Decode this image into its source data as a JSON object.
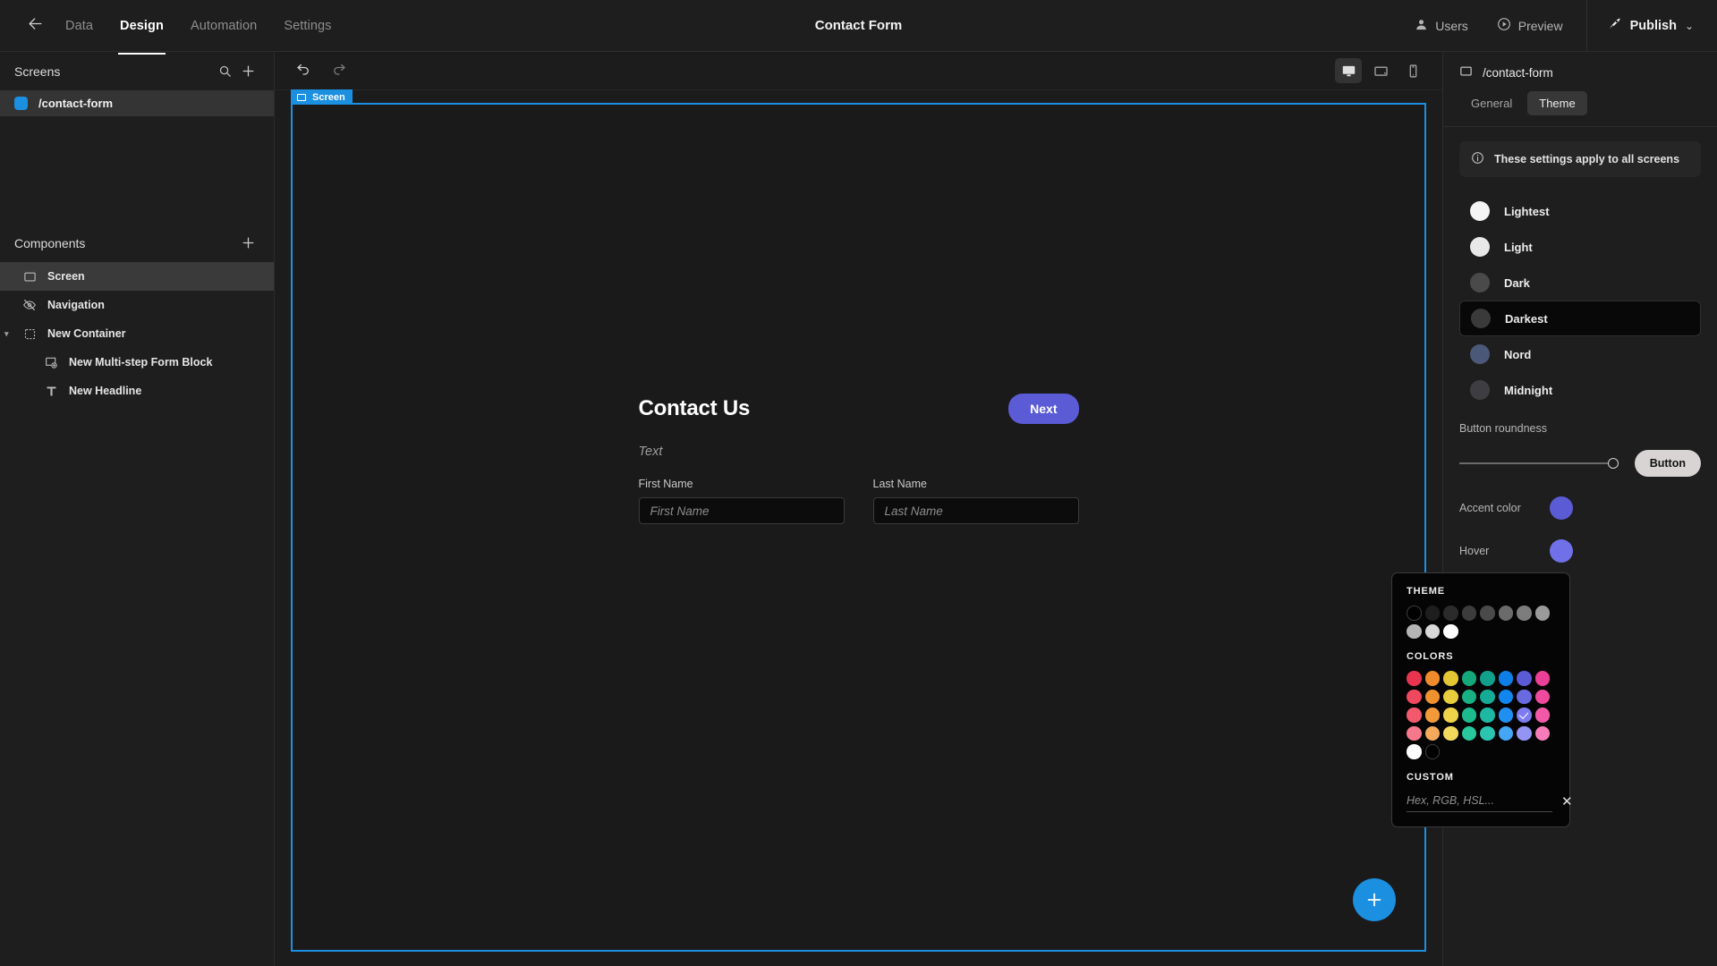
{
  "topbar": {
    "back_icon": "arrow-left-icon",
    "tabs": [
      {
        "label": "Data",
        "active": false
      },
      {
        "label": "Design",
        "active": true
      },
      {
        "label": "Automation",
        "active": false
      },
      {
        "label": "Settings",
        "active": false
      }
    ],
    "title": "Contact Form",
    "users_label": "Users",
    "preview_label": "Preview",
    "publish_label": "Publish",
    "publish_chevron": "⌄"
  },
  "left_panel": {
    "screens_header": "Screens",
    "search_icon": "search-icon",
    "add_icon": "plus-icon",
    "screens": [
      {
        "label": "/contact-form",
        "color": "#1b8fe0",
        "selected": true
      }
    ],
    "components_header": "Components",
    "components_add_icon": "plus-icon",
    "components": [
      {
        "label": "Screen",
        "icon": "screen-icon",
        "indent": 0,
        "selected": true,
        "caret": false
      },
      {
        "label": "Navigation",
        "icon": "eye-off-icon",
        "indent": 0,
        "selected": false,
        "caret": false
      },
      {
        "label": "New Container",
        "icon": "container-icon",
        "indent": 0,
        "selected": false,
        "caret": true
      },
      {
        "label": "New Multi-step Form Block",
        "icon": "form-block-icon",
        "indent": 1,
        "selected": false,
        "caret": false
      },
      {
        "label": "New Headline",
        "icon": "text-icon",
        "indent": 1,
        "selected": false,
        "caret": false
      }
    ]
  },
  "canvas": {
    "undo_icon": "undo-icon",
    "redo_icon": "redo-icon",
    "devices": [
      {
        "name": "desktop-icon",
        "active": true
      },
      {
        "name": "tablet-icon",
        "active": false
      },
      {
        "name": "mobile-icon",
        "active": false
      }
    ],
    "artboard_tag": "Screen",
    "form": {
      "title": "Contact Us",
      "next_label": "Next",
      "subtitle": "Text",
      "fields": [
        {
          "label": "First Name",
          "placeholder": "First Name",
          "value": ""
        },
        {
          "label": "Last Name",
          "placeholder": "Last Name",
          "value": ""
        }
      ]
    },
    "fab_icon": "plus-icon",
    "fab_label": "+"
  },
  "right_panel": {
    "screen_name": "/contact-form",
    "screen_icon": "screen-icon",
    "tabs": [
      {
        "label": "General",
        "active": false
      },
      {
        "label": "Theme",
        "active": true
      }
    ],
    "info_text": "These settings apply to all screens",
    "info_icon": "info-icon",
    "themes": [
      {
        "label": "Lightest",
        "swatch": "#f4f4f4",
        "selected": false
      },
      {
        "label": "Light",
        "swatch": "#e8e8e8",
        "selected": false
      },
      {
        "label": "Dark",
        "swatch": "#4a4a4a",
        "selected": false
      },
      {
        "label": "Darkest",
        "swatch": "#3a3a3a",
        "selected": true
      },
      {
        "label": "Nord",
        "swatch": "#4c5878",
        "selected": false
      },
      {
        "label": "Midnight",
        "swatch": "#3e3e42",
        "selected": false
      }
    ],
    "roundness_label": "Button roundness",
    "roundness_value": 100,
    "button_preview_label": "Button",
    "accent_label": "Accent color",
    "accent_color": "#5b5bd6",
    "hover_label": "Hover",
    "hover_color": "#7070e8"
  },
  "color_popup": {
    "theme_title": "THEME",
    "theme_swatches": [
      "#000000",
      "#1e1e1e",
      "#2b2b2b",
      "#3c3c3c",
      "#4a4a4a",
      "#6b6b6b",
      "#7d7d7d",
      "#9a9a9a",
      "#b5b5b5",
      "#d8d8d8",
      "#ffffff"
    ],
    "colors_title": "COLORS",
    "color_swatches": [
      "#e8344e",
      "#ef8b2c",
      "#e4c534",
      "#14a87a",
      "#12a08d",
      "#0f7fe8",
      "#5b5bd6",
      "#ec3f96",
      "#f0485f",
      "#f0912f",
      "#e8cd3c",
      "#18b183",
      "#16ab96",
      "#1186ef",
      "#6a6ae0",
      "#ef4a9e",
      "#f2596d",
      "#f2993a",
      "#eed34a",
      "#1cbb8e",
      "#1db7a2",
      "#1f90f2",
      "#7c7cf0",
      "#f25aa8",
      "#f5798a",
      "#f5a95a",
      "#f2d95e",
      "#28c79c",
      "#2bc4b0",
      "#44a6f5",
      "#9494f5",
      "#f57cb8"
    ],
    "selected_index": 22,
    "bw_swatches": [
      "#ffffff",
      "#000000"
    ],
    "custom_title": "CUSTOM",
    "custom_placeholder": "Hex, RGB, HSL...",
    "custom_value": "",
    "close_icon": "close-icon",
    "close_glyph": "✕"
  }
}
